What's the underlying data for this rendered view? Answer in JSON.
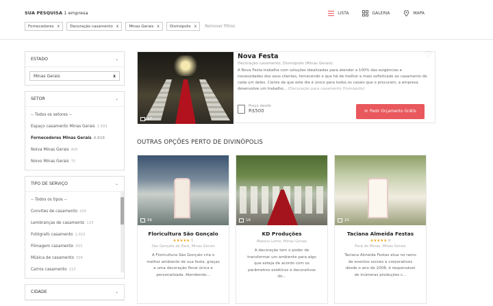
{
  "header": {
    "search_label": "SUA PESQUISA",
    "search_count": "1 empresa",
    "chips": [
      {
        "label": "Fornecedores",
        "x": "x"
      },
      {
        "label": "Decoração casamento",
        "x": "x"
      },
      {
        "label": "Minas Gerais",
        "x": "x"
      },
      {
        "label": "Divinópolis",
        "x": "x"
      }
    ],
    "remove_filters": "Remover filtros",
    "views": [
      {
        "label": "LISTA",
        "icon": "list-icon"
      },
      {
        "label": "GALERIA",
        "icon": "grid-icon"
      },
      {
        "label": "MAPA",
        "icon": "map-pin-icon"
      }
    ]
  },
  "sidebar": {
    "state": {
      "title": "ESTADO",
      "value": "Minas Gerais",
      "clear": "x"
    },
    "sector": {
      "title": "SETOR",
      "items": [
        {
          "label": "-- Todos os setores --",
          "count": ""
        },
        {
          "label": "Espaço casamento Minas Gerais",
          "count": "1.593"
        },
        {
          "label": "Fornecedores Minas Gerais",
          "count": "4.619"
        },
        {
          "label": "Noiva Minas Gerais",
          "count": "405"
        },
        {
          "label": "Noivo Minas Gerais",
          "count": "75"
        }
      ]
    },
    "service": {
      "title": "TIPO DE SERVIÇO",
      "items": [
        {
          "label": "-- Todos os tipos --",
          "count": ""
        },
        {
          "label": "Convites de casamento",
          "count": "100"
        },
        {
          "label": "Lembranças de casamento",
          "count": "133"
        },
        {
          "label": "Fotógrafo casamento",
          "count": "1.023"
        },
        {
          "label": "Filmagem casamento",
          "count": "333"
        },
        {
          "label": "Música de casamento",
          "count": "504"
        },
        {
          "label": "Carros casamento",
          "count": "113"
        }
      ]
    },
    "next_title": "CIDADE"
  },
  "featured": {
    "title": "Nova Festa",
    "subtitle": "Decoração casamento, Divinópolis (Minas Gerais)",
    "description": "A Nova Festa trabalha com soluções idealizadas para atender a 100% das exigências e necessidades dos seus clientes, fornecendo o que há de melhor e mais sofisticado ao casamento de cada um deles. Ciente de que este dia é único para todos os casais que o procuram, a empresa desenvolve um trabalho...",
    "more": "(Decoração para casamento Divinópolis)",
    "photos": "17",
    "price_label": "Preço desde",
    "price_value": "R$500",
    "cta": "Pedir Orçamento Grátis"
  },
  "section_title": "OUTRAS OPÇÕES PERTO DE DIVINÓPOLIS",
  "cards": [
    {
      "name": "Floricultura São Gonçalo",
      "rating": "1",
      "location": "São Gonçalo do Pará, Minas Gerais",
      "photos": "56",
      "desc": "A Floricultura São Gonçalo cria o melhor ambiente de sua festa, graças a uma decoração floral única e personalizada. Atendendo..."
    },
    {
      "name": "KD Produções",
      "rating": "",
      "location": "Mateus Leme, Minas Gerais",
      "photos": "16",
      "desc": "A decoração tem o poder de transformar um ambiente para algo que esteja de acordo com os parâmetros estéticos e decorativos do..."
    },
    {
      "name": "Taciana Almeida Festas",
      "rating": "9",
      "location": "Pará de Minas, Minas Gerais",
      "photos": "25",
      "desc": "Taciana Almeida Festas atua no ramo de eventos sociais e corporativos desde o ano de 2008, é responsável de inúmeras produções c..."
    }
  ]
}
